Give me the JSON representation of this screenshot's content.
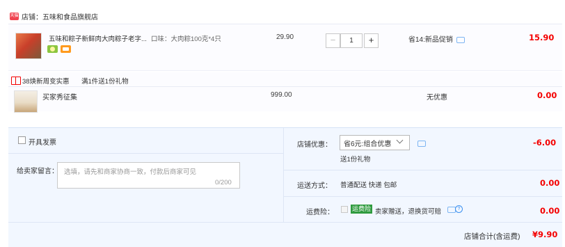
{
  "store": {
    "badge": "天猫",
    "label": "店铺：五味和食品旗舰店"
  },
  "item": {
    "title": "五味和粽子新鲜肉大肉粽子老字...",
    "option": "口味：大肉粽100克*4只",
    "unit_price": "29.90",
    "quantity": "1",
    "minus": "−",
    "plus": "+",
    "promo": "省14:新品促销",
    "subtotal": "15.90"
  },
  "gift": {
    "label": "38焕新周变实惠",
    "rule": "满1件送1份礼物",
    "name": "买家秀征集",
    "price": "999.00",
    "promo": "无优惠",
    "subtotal": "0.00"
  },
  "invoice": {
    "label": "开具发票"
  },
  "message": {
    "label": "给卖家留言：",
    "placeholder": "选填，请先和商家协商一致，付款后商家可见",
    "count": "0/200"
  },
  "discount": {
    "label": "店铺优惠：",
    "selected": "省6元:组合优惠",
    "sub": "送1份礼物",
    "amount": "-6.00"
  },
  "shipping": {
    "label": "运送方式：",
    "value": "普通配送 快递 包邮",
    "amount": "0.00"
  },
  "insurance": {
    "label": "运费险：",
    "tag": "运费险",
    "text": "卖家赠送，退换货可赔",
    "help": "?",
    "amount": "0.00"
  },
  "total": {
    "label": "店铺合计(含运费)",
    "amount": "¥9.90"
  },
  "colors": {
    "accent_red": "#f40000",
    "panel_bg": "#f2f7ff",
    "insurance_green": "#2f9b3f"
  }
}
